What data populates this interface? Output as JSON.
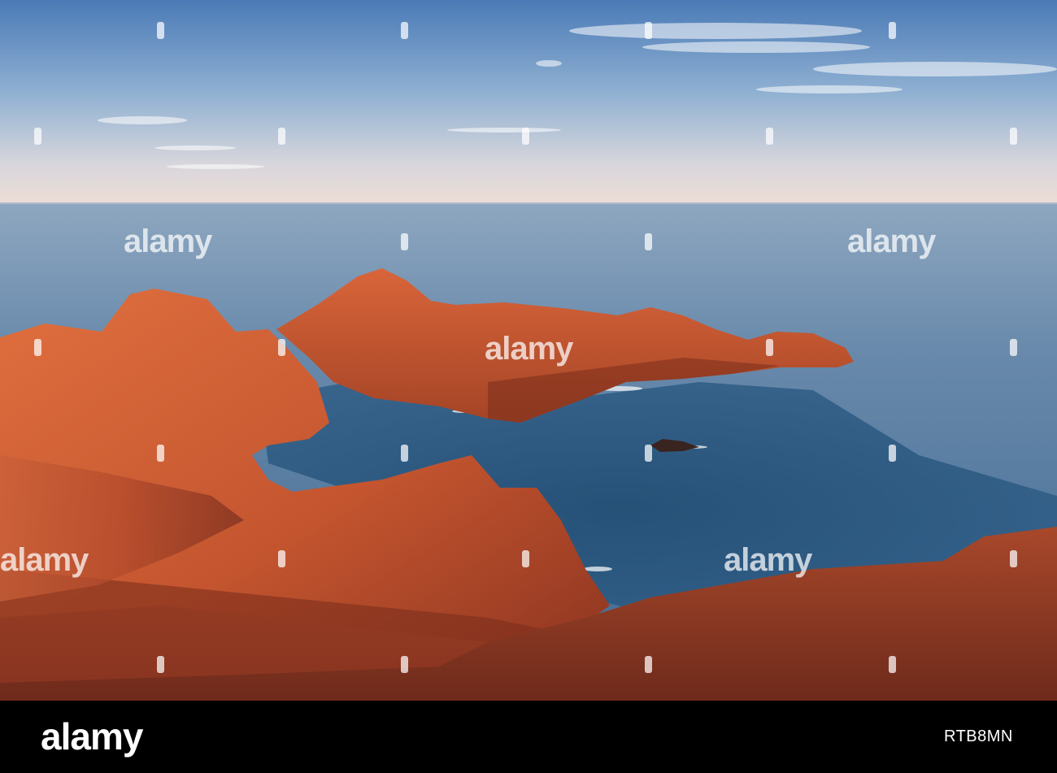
{
  "scene": {
    "description_tag": "red-rock-coastline-at-sunset",
    "colors": {
      "sky_top": "#4f7fb8",
      "sky_horizon": "#ecdcd5",
      "sea_far": "#7f9bb8",
      "sea_near": "#1f4f76",
      "rock_lit": "#d8643a",
      "rock_shadow": "#8a3320",
      "footer_bg": "#000000"
    }
  },
  "footer": {
    "logo": "alamy",
    "image_id": "RTB8MN"
  },
  "watermark": {
    "text": "alamy"
  }
}
